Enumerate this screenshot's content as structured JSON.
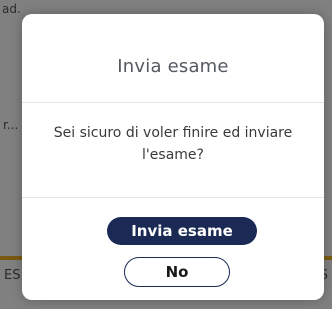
{
  "background": {
    "top_text": "ad.",
    "mid_text": "r...",
    "bottom_left_text": "ES",
    "bottom_right_text": "S"
  },
  "modal": {
    "title": "Invia esame",
    "message": "Sei sicuro di voler finire ed inviare l'esame?",
    "confirm_label": "Invia esame",
    "cancel_label": "No"
  },
  "colors": {
    "overlay": "#808080",
    "primary_button": "#1a2a55",
    "title_text": "#555a60",
    "accent_bar": "#7a5a12"
  }
}
